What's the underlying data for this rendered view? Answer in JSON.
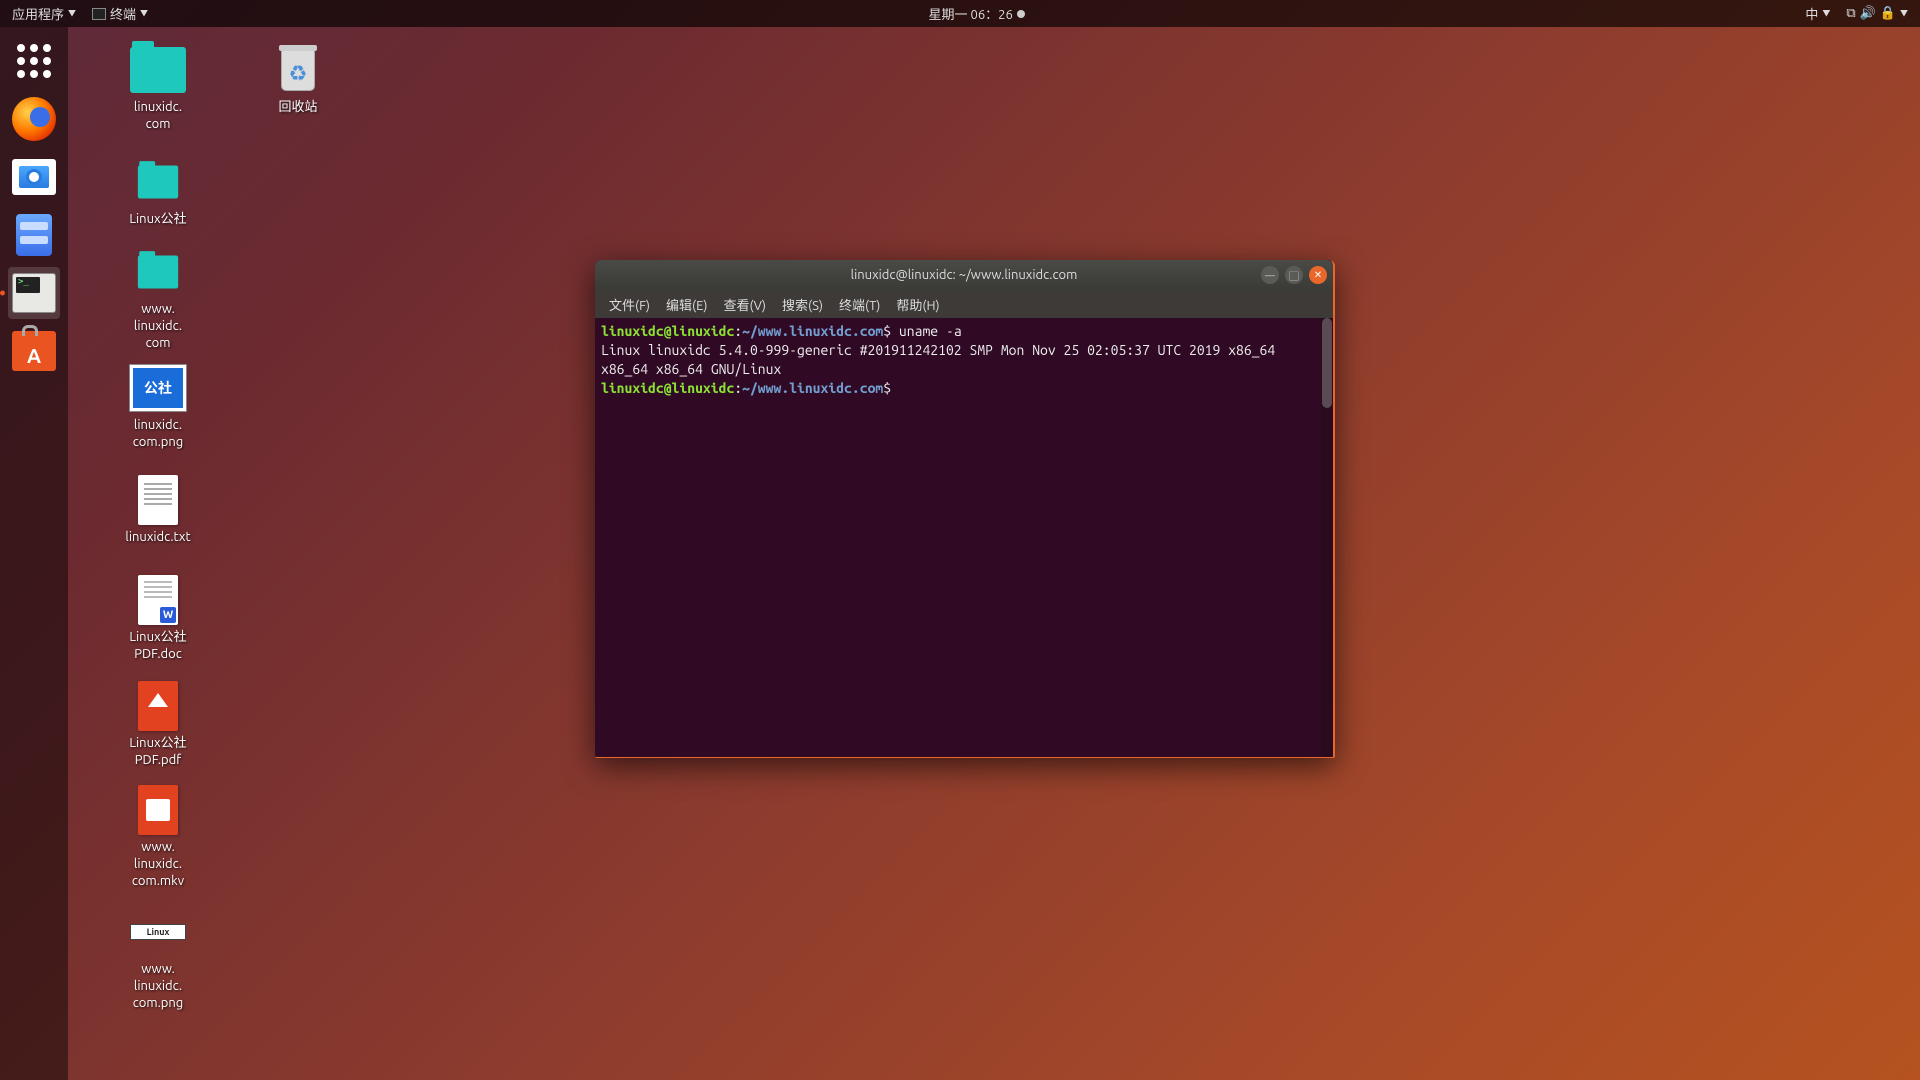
{
  "top_panel": {
    "apps_label": "应用程序",
    "current_app_icon": "terminal",
    "current_app_label": "终端",
    "clock": "星期一 06：26",
    "ime": "中"
  },
  "dock": {
    "items": [
      {
        "name": "show-applications",
        "running": false
      },
      {
        "name": "firefox",
        "running": false
      },
      {
        "name": "shotwell",
        "running": false
      },
      {
        "name": "files",
        "running": false
      },
      {
        "name": "terminal",
        "running": true
      },
      {
        "name": "software-center",
        "running": false
      }
    ]
  },
  "desktop_icons": [
    {
      "type": "folder",
      "label": "linuxidc.\ncom"
    },
    {
      "type": "trash",
      "label": "回收站"
    },
    {
      "type": "folder",
      "label": "Linux公社"
    },
    {
      "type": "folder",
      "label": "www.\nlinuxidc.\ncom"
    },
    {
      "type": "image-thumb",
      "thumb_text": "公社",
      "label": "linuxidc.\ncom.png"
    },
    {
      "type": "text",
      "label": "linuxidc.txt"
    },
    {
      "type": "doc",
      "label": "Linux公社\nPDF.doc"
    },
    {
      "type": "pdf",
      "label": "Linux公社\nPDF.pdf"
    },
    {
      "type": "video",
      "label": "www.\nlinuxidc.\ncom.mkv"
    },
    {
      "type": "image-thumb2",
      "thumb_text": "Linux",
      "label": "www.\nlinuxidc.\ncom.png"
    }
  ],
  "terminal": {
    "title": "linuxidc@linuxidc: ~/www.linuxidc.com",
    "menu": {
      "file": "文件(F)",
      "edit": "编辑(E)",
      "view": "查看(V)",
      "search": "搜索(S)",
      "terminal": "终端(T)",
      "help": "帮助(H)"
    },
    "prompt_user_host": "linuxidc@linuxidc",
    "prompt_sep": ":",
    "prompt_path": "~/www.linuxidc.com",
    "prompt_symbol": "$",
    "command1": " uname -a",
    "output": "Linux linuxidc 5.4.0-999-generic #201911242102 SMP Mon Nov 25 02:05:37 UTC 2019 x86_64 x86_64 x86_64 GNU/Linux"
  }
}
